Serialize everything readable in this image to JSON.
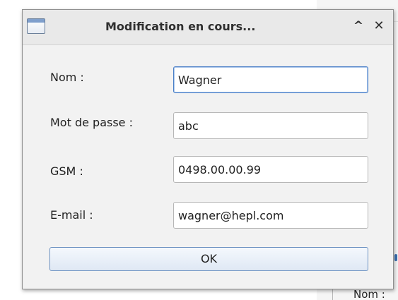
{
  "background": {
    "partial_label": "Nom :"
  },
  "dialog": {
    "title": "Modification en cours...",
    "icons": {
      "window": "window-icon",
      "maximize": "chevron-up-icon",
      "close": "close-icon"
    },
    "maximize_glyph": "^",
    "close_glyph": "✕",
    "fields": [
      {
        "label": "Nom :",
        "value": "Wagner"
      },
      {
        "label": "Mot de passe :",
        "value": "abc"
      },
      {
        "label": "GSM :",
        "value": "0498.00.00.99"
      },
      {
        "label": "E-mail :",
        "value": "wagner@hepl.com"
      }
    ],
    "ok_label": "OK"
  },
  "colors": {
    "focus_border": "#4a7fc7",
    "button_border": "#6e93c2"
  }
}
